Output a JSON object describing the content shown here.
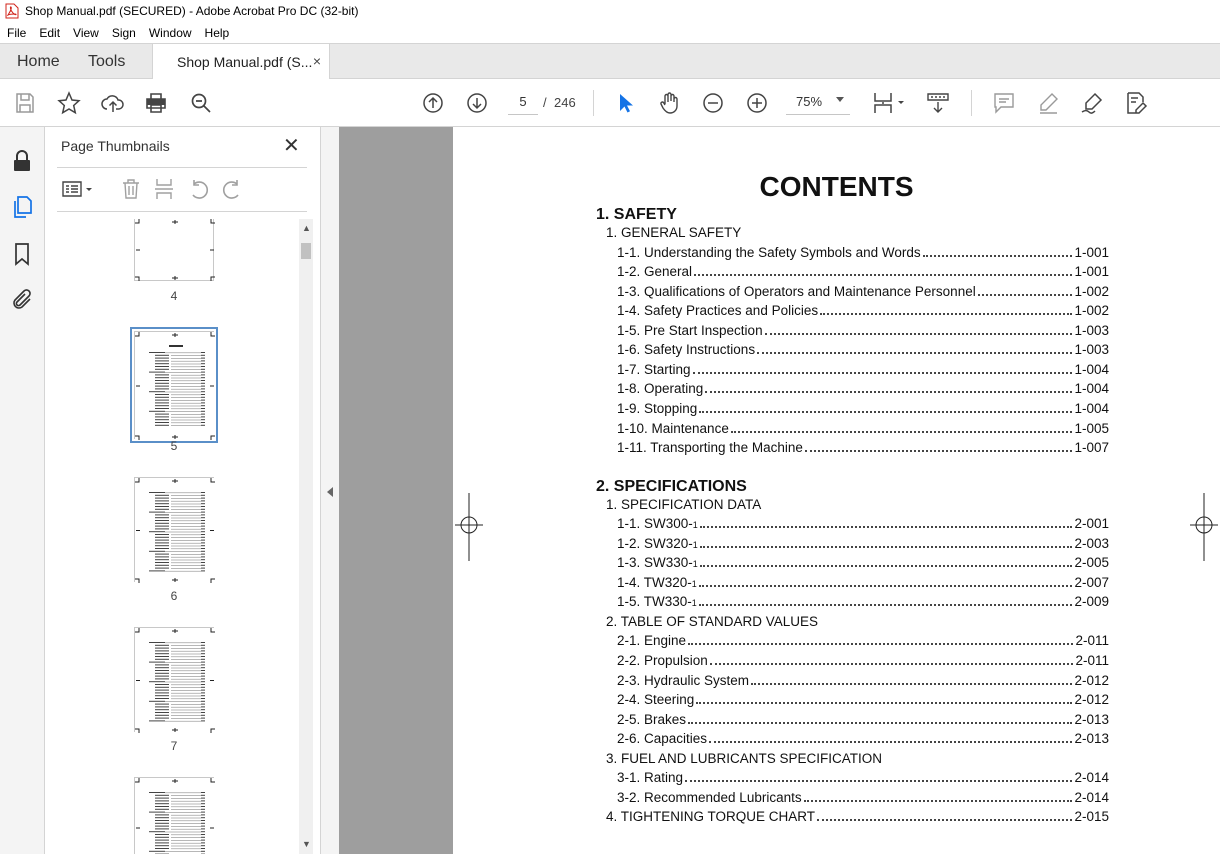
{
  "window": {
    "title": "Shop Manual.pdf (SECURED) - Adobe Acrobat Pro DC (32-bit)"
  },
  "menu": [
    "File",
    "Edit",
    "View",
    "Sign",
    "Window",
    "Help"
  ],
  "tabs": {
    "home": "Home",
    "tools": "Tools",
    "document": "Shop Manual.pdf (S...",
    "close": "×"
  },
  "toolbar": {
    "current_page": "5",
    "page_separator": "/",
    "total_pages": "246",
    "zoom": "75%"
  },
  "sidebar_icons": [
    "lock-icon",
    "pages-icon",
    "bookmark-icon",
    "attachment-icon"
  ],
  "thumbnails_panel": {
    "title": "Page Thumbnails",
    "close": "✕",
    "pages": [
      {
        "label": "4",
        "selected": false
      },
      {
        "label": "5",
        "selected": true
      },
      {
        "label": "6",
        "selected": false
      },
      {
        "label": "7",
        "selected": false
      },
      {
        "label": "",
        "selected": false
      }
    ]
  },
  "document": {
    "title": "CONTENTS",
    "sections": [
      {
        "heading": "1. SAFETY",
        "groups": [
          {
            "heading": "1. GENERAL SAFETY",
            "entries": [
              {
                "label": "1-1. Understanding the Safety Symbols and Words",
                "page": "1-001"
              },
              {
                "label": "1-2. General",
                "page": "1-001"
              },
              {
                "label": "1-3. Qualifications of Operators and Maintenance Personnel",
                "page": "1-002"
              },
              {
                "label": "1-4. Safety Practices and Policies",
                "page": "1-002"
              },
              {
                "label": "1-5. Pre Start Inspection",
                "page": "1-003"
              },
              {
                "label": "1-6. Safety Instructions",
                "page": "1-003"
              },
              {
                "label": "1-7. Starting",
                "page": "1-004"
              },
              {
                "label": "1-8. Operating",
                "page": "1-004"
              },
              {
                "label": "1-9. Stopping",
                "page": "1-004"
              },
              {
                "label": "1-10. Maintenance",
                "page": "1-005"
              },
              {
                "label": "1-11. Transporting the Machine",
                "page": "1-007"
              }
            ]
          }
        ]
      },
      {
        "heading": "2. SPECIFICATIONS",
        "groups": [
          {
            "heading": "1. SPECIFICATION DATA",
            "entries": [
              {
                "label": "1-1. SW300-1",
                "page": "2-001"
              },
              {
                "label": "1-2. SW320-1",
                "page": "2-003"
              },
              {
                "label": "1-3. SW330-1",
                "page": "2-005"
              },
              {
                "label": "1-4. TW320-1",
                "page": "2-007"
              },
              {
                "label": "1-5. TW330-1",
                "page": "2-009"
              }
            ]
          },
          {
            "heading": "2. TABLE OF STANDARD VALUES",
            "entries": [
              {
                "label": "2-1. Engine",
                "page": "2-011"
              },
              {
                "label": "2-2. Propulsion",
                "page": "2-011"
              },
              {
                "label": "2-3. Hydraulic System",
                "page": "2-012"
              },
              {
                "label": "2-4. Steering",
                "page": "2-012"
              },
              {
                "label": "2-5. Brakes",
                "page": "2-013"
              },
              {
                "label": "2-6. Capacities",
                "page": "2-013"
              }
            ]
          },
          {
            "heading": "3. FUEL AND LUBRICANTS SPECIFICATION",
            "entries": [
              {
                "label": "3-1. Rating",
                "page": "2-014"
              },
              {
                "label": "3-2. Recommended Lubricants",
                "page": "2-014"
              }
            ]
          },
          {
            "heading": "4. TIGHTENING TORQUE CHART",
            "page": "2-015"
          }
        ]
      }
    ]
  },
  "colors": {
    "accent_blue": "#1473e6",
    "viewer_bg": "#9e9e9e",
    "selection": "#5a8fc8"
  }
}
